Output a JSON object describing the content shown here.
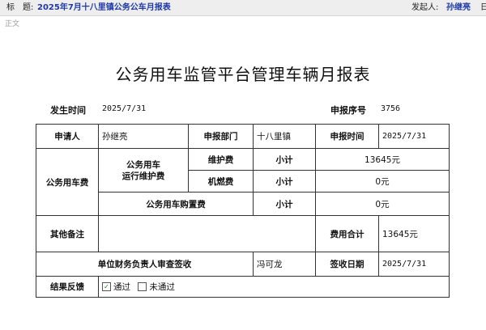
{
  "header": {
    "title_label": "标　题:",
    "title": "2025年7月十八里镇公务公车月报表",
    "sender_label": "发起人:",
    "sender": "孙继亮",
    "trailing": "日"
  },
  "tab": "正文",
  "doc": {
    "title": "公务用车监管平台管理车辆月报表",
    "occur_time_label": "发生时间",
    "occur_time": "2025/7/31",
    "serial_label": "申报序号",
    "serial": "3756"
  },
  "form": {
    "applicant_label": "申请人",
    "applicant": "孙继亮",
    "dept_label": "申报部门",
    "dept": "十八里镇",
    "apply_time_label": "申报时间",
    "apply_time": "2025/7/31",
    "vehicle_cost_label": "公务用车费",
    "maint_group_label": "公务用车\n运行维护费",
    "repair_label": "维护费",
    "subtotal_label": "小计",
    "repair_amount": "13645元",
    "fuel_label": "机燃费",
    "fuel_amount": "0元",
    "purchase_label": "公务用车购置费",
    "purchase_amount": "0元",
    "remarks_label": "其他备注",
    "remarks": "",
    "total_label": "费用合计",
    "total": "13645元",
    "finance_label": "单位财务负责人审查签收",
    "finance_signer": "冯可龙",
    "sign_date_label": "签收日期",
    "sign_date": "2025/7/31",
    "feedback_label": "结果反馈",
    "option_pass": "通过",
    "option_fail": "未通过",
    "option_pass_checked": true,
    "check_mark": "✓"
  }
}
